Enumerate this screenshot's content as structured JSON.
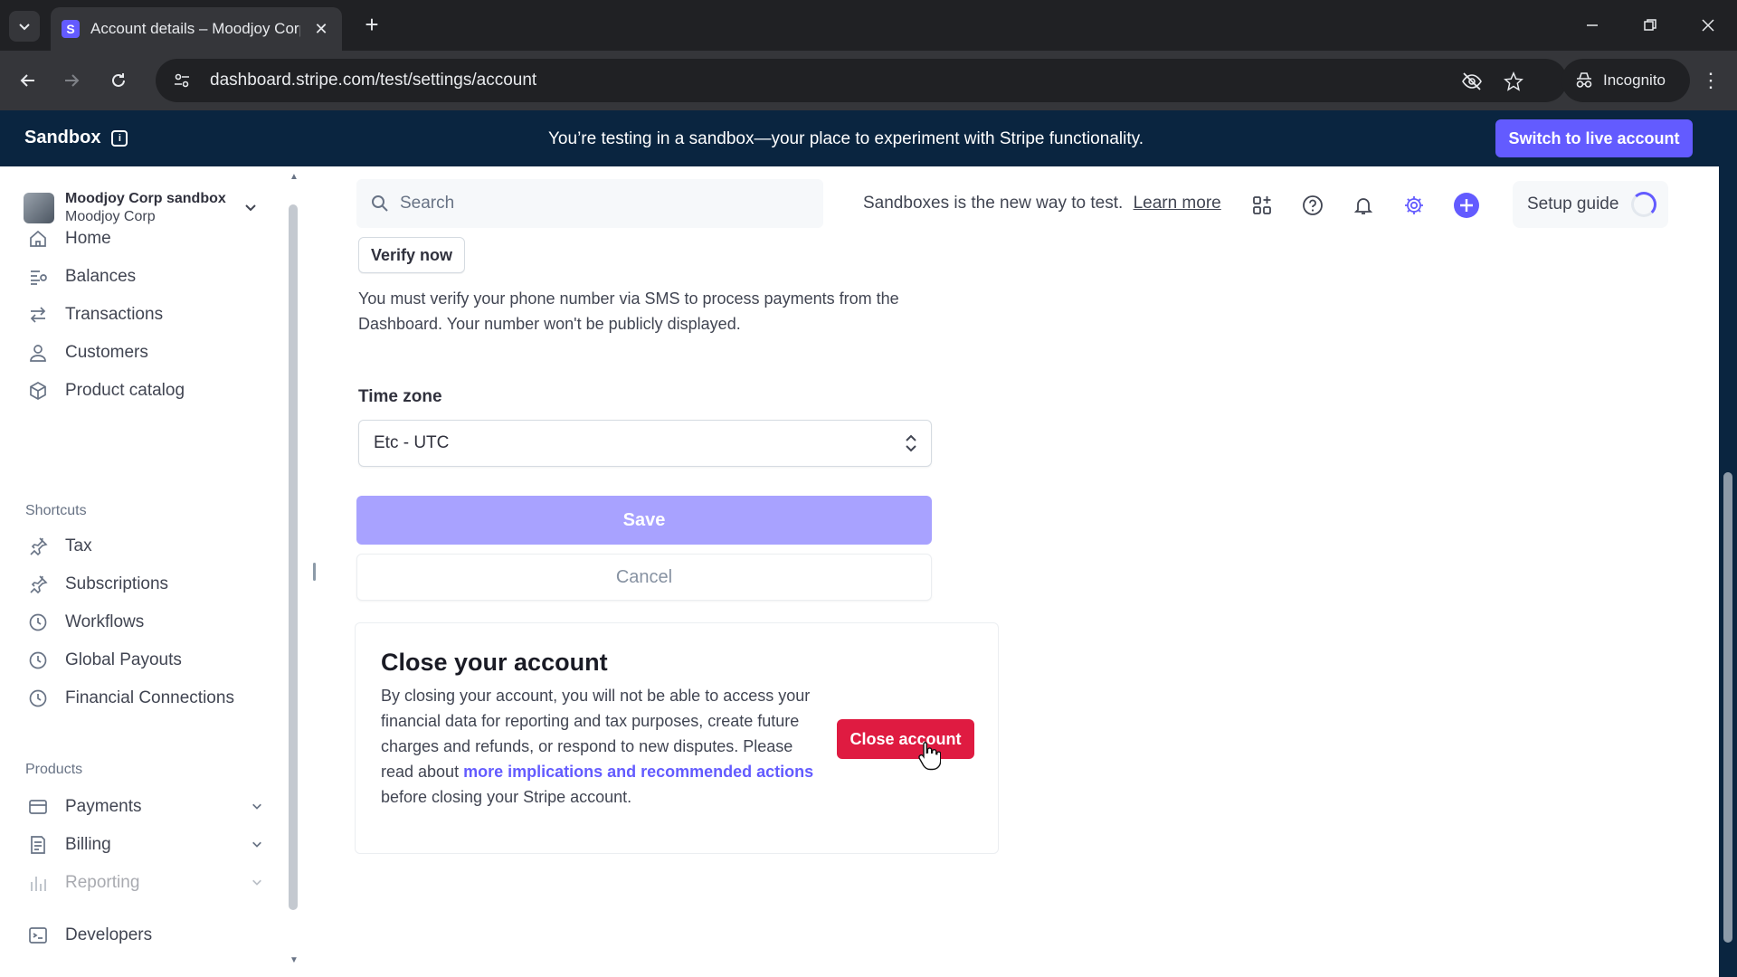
{
  "browser": {
    "tab_title": "Account details – Moodjoy Corp",
    "favicon_letter": "S",
    "url": "dashboard.stripe.com/test/settings/account",
    "incognito_label": "Incognito"
  },
  "sandbox_banner": {
    "label": "Sandbox",
    "message": "You’re testing in a sandbox—your place to experiment with Stripe functionality.",
    "switch_button": "Switch to live account",
    "info_glyph": "i"
  },
  "account": {
    "name": "Moodjoy Corp sandbox",
    "subname": "Moodjoy Corp"
  },
  "sidebar": {
    "items": [
      {
        "label": "Home",
        "icon": "home-icon"
      },
      {
        "label": "Balances",
        "icon": "balances-icon"
      },
      {
        "label": "Transactions",
        "icon": "transactions-icon"
      },
      {
        "label": "Customers",
        "icon": "customers-icon"
      },
      {
        "label": "Product catalog",
        "icon": "product-catalog-icon"
      }
    ],
    "shortcuts_label": "Shortcuts",
    "shortcuts": [
      {
        "label": "Tax",
        "icon": "pin-icon"
      },
      {
        "label": "Subscriptions",
        "icon": "pin-icon"
      },
      {
        "label": "Workflows",
        "icon": "clock-icon"
      },
      {
        "label": "Global Payouts",
        "icon": "clock-icon"
      },
      {
        "label": "Financial Connections",
        "icon": "clock-icon"
      }
    ],
    "products_label": "Products",
    "products": [
      {
        "label": "Payments",
        "icon": "payments-icon"
      },
      {
        "label": "Billing",
        "icon": "billing-icon"
      },
      {
        "label": "Reporting",
        "icon": "reporting-icon"
      }
    ],
    "developers_label": "Developers"
  },
  "topbar": {
    "search_placeholder": "Search",
    "promo_text": "Sandboxes is the new way to test.",
    "promo_link": "Learn more",
    "setup_guide": "Setup guide"
  },
  "content": {
    "verify_button": "Verify now",
    "verify_help": "You must verify your phone number via SMS to process payments from the Dashboard. Your number won't be publicly displayed.",
    "timezone_label": "Time zone",
    "timezone_value": "Etc - UTC",
    "save_button": "Save",
    "cancel_button": "Cancel"
  },
  "close_account": {
    "title": "Close your account",
    "body_before": "By closing your account, you will not be able to access your financial data for reporting and tax purposes, create future charges and refunds, or respond to new disputes. Please read about ",
    "link": "more implications and recommended actions",
    "body_after": " before closing your Stripe account.",
    "button": "Close account"
  },
  "colors": {
    "brand": "#635bff",
    "banner": "#0a2540",
    "danger": "#df1b41",
    "save_disabled": "#a8a2ff"
  }
}
